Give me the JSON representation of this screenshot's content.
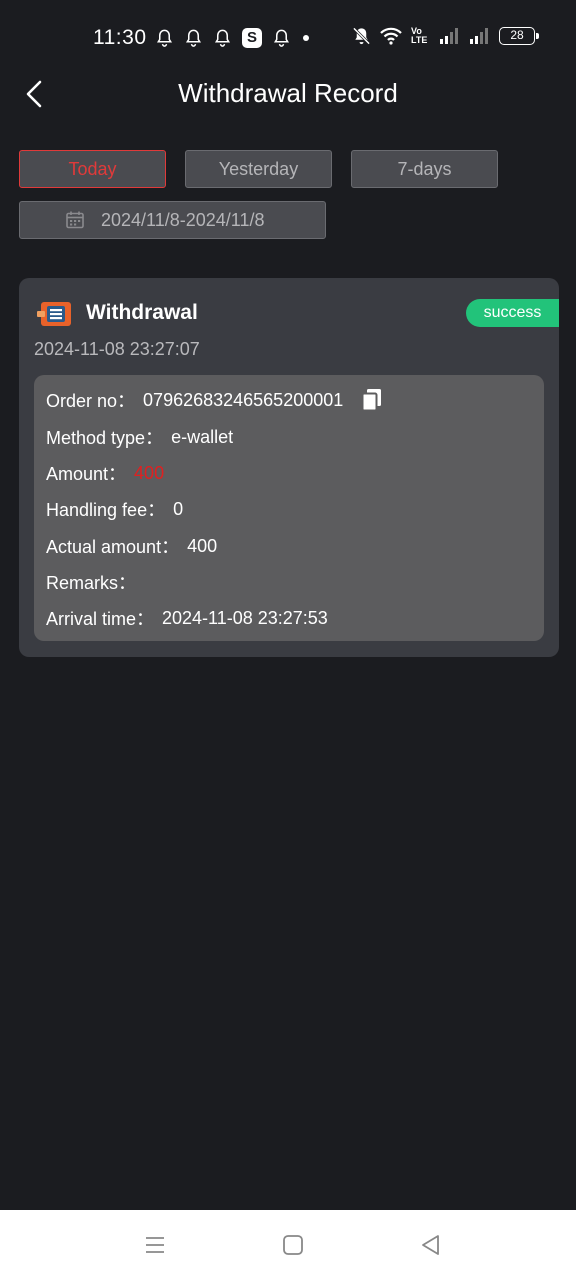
{
  "status_bar": {
    "time": "11:30",
    "battery": "28",
    "app_badge": "S",
    "signal_label": "Vo LTE"
  },
  "header": {
    "title": "Withdrawal Record"
  },
  "filters": {
    "today": "Today",
    "yesterday": "Yesterday",
    "seven_days": "7-days",
    "active": "Today",
    "date_range": "2024/11/8-2024/11/8"
  },
  "record": {
    "type": "Withdrawal",
    "status": "success",
    "time": "2024-11-08 23:27:07",
    "order_no_label": "Order no：",
    "order_no": "07962683246565200001",
    "method_label": "Method type：",
    "method": "e-wallet",
    "amount_label": "Amount：",
    "amount": "400",
    "fee_label": "Handling fee：",
    "fee": "0",
    "actual_label": "Actual amount：",
    "actual": "400",
    "remarks_label": "Remarks：",
    "remarks": "",
    "arrival_label": "Arrival time：",
    "arrival": "2024-11-08 23:27:53"
  },
  "colors": {
    "background": "#1b1c20",
    "card": "#3a3c42",
    "details": "#5c5c5e",
    "success": "#22c37a",
    "accent_red": "#e03a3a"
  }
}
